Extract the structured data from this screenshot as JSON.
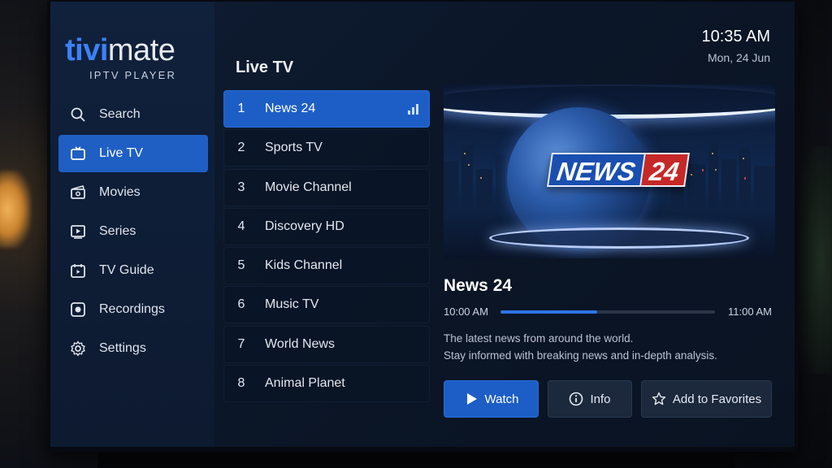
{
  "app": {
    "logo_part1": "tivi",
    "logo_part2": "mate",
    "logo_subtitle": "IPTV PLAYER"
  },
  "sidebar": {
    "items": [
      {
        "label": "Search",
        "icon": "search-icon",
        "active": false
      },
      {
        "label": "Live TV",
        "icon": "tv-icon",
        "active": true
      },
      {
        "label": "Movies",
        "icon": "film-icon",
        "active": false
      },
      {
        "label": "Series",
        "icon": "series-icon",
        "active": false
      },
      {
        "label": "TV Guide",
        "icon": "calendar-icon",
        "active": false
      },
      {
        "label": "Recordings",
        "icon": "record-icon",
        "active": false
      },
      {
        "label": "Settings",
        "icon": "gear-icon",
        "active": false
      }
    ]
  },
  "channel_list": {
    "title": "Live TV",
    "channels": [
      {
        "number": "1",
        "name": "News 24",
        "active": true
      },
      {
        "number": "2",
        "name": "Sports TV",
        "active": false
      },
      {
        "number": "3",
        "name": "Movie Channel",
        "active": false
      },
      {
        "number": "4",
        "name": "Discovery HD",
        "active": false
      },
      {
        "number": "5",
        "name": "Kids Channel",
        "active": false
      },
      {
        "number": "6",
        "name": "Music TV",
        "active": false
      },
      {
        "number": "7",
        "name": "World News",
        "active": false
      },
      {
        "number": "8",
        "name": "Animal Planet",
        "active": false
      }
    ]
  },
  "clock": {
    "time": "10:35 AM",
    "date": "Mon, 24 Jun"
  },
  "preview": {
    "logo_word": "NEWS",
    "logo_number": "24"
  },
  "program": {
    "title": "News 24",
    "start_time": "10:00 AM",
    "end_time": "11:00 AM",
    "progress": 0.45,
    "description_line1": "The latest news from around the world.",
    "description_line2": "Stay informed with breaking news and in-depth analysis."
  },
  "actions": {
    "watch_label": "Watch",
    "info_label": "Info",
    "favorite_label": "Add to Favorites"
  },
  "colors": {
    "accent": "#1d5ec6",
    "logo_blue": "#3b82f6",
    "news_red": "#c62828"
  }
}
